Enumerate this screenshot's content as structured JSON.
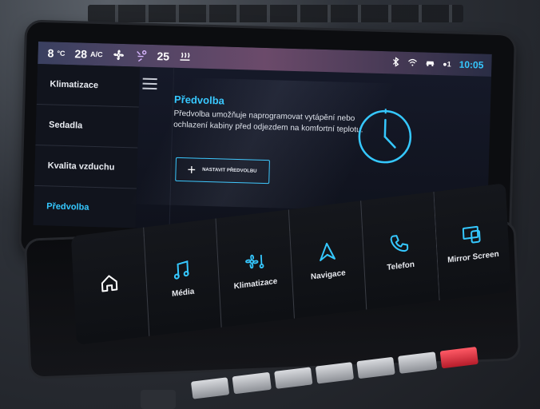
{
  "status": {
    "temp_left": "8",
    "temp_left_unit": "°C",
    "fan_level": "28",
    "ac_label": "A/C",
    "temp_right": "25",
    "time": "10:05",
    "icons": [
      "fan-icon",
      "airflow-icon",
      "seat-heat-icon",
      "bluetooth-icon",
      "wifi-icon",
      "car-icon",
      "signal-icon"
    ]
  },
  "sidebar": {
    "items": [
      {
        "label": "Klimatizace"
      },
      {
        "label": "Sedadla"
      },
      {
        "label": "Kvalita vzduchu"
      },
      {
        "label": "Předvolba",
        "active": true
      }
    ]
  },
  "content": {
    "title": "Předvolba",
    "description": "Předvolba umožňuje naprogramovat vytápění nebo ochlazení kabiny před odjezdem na komfortní teplotu.",
    "button_label": "NASTAVIT PŘEDVOLBU"
  },
  "shortcuts": [
    {
      "label": "",
      "icon": "home-icon"
    },
    {
      "label": "Média",
      "icon": "music-icon"
    },
    {
      "label": "Klimatizace",
      "icon": "climate-icon"
    },
    {
      "label": "Navigace",
      "icon": "navigation-icon"
    },
    {
      "label": "Telefon",
      "icon": "phone-icon"
    },
    {
      "label": "Mirror Screen",
      "icon": "mirror-screen-icon"
    }
  ],
  "colors": {
    "accent": "#35c8ff",
    "background": "#0f121c",
    "text": "#e9ecf2"
  }
}
